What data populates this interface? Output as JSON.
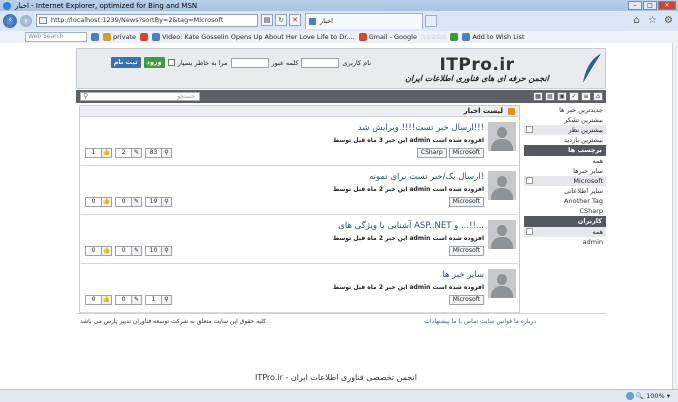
{
  "browser": {
    "title": "اخبار - Internet Explorer, optimized for Bing and MSN",
    "address": "http://localhost:1239/News?sortBy=2&tag=Microsoft",
    "tab_label": "اخبار",
    "search_placeholder": "Web Search",
    "toolbar_items": [
      "private",
      "Video: Kate Gosselin Opens Up About Her Love Life to Dr....",
      "Gmail - Google",
      "Add to Wish List"
    ],
    "zoom": "100%"
  },
  "site": {
    "logo": "ITPro.ir",
    "tagline": "انجمن حرفه ای های فناوری اطلاعات ایران",
    "login": {
      "username_label": "نام کاربری",
      "password_label": "کلمه عبور",
      "remember_label": "مرا به خاطر بسپار",
      "login_button": "ورود",
      "register_button": "ثبت نام"
    },
    "search_placeholder": "جستجو"
  },
  "sidebar": {
    "tabs": [
      {
        "label": "جدیدترین خبر ها",
        "style": "link"
      },
      {
        "label": "بیشترین تشکر",
        "style": "link"
      },
      {
        "label": "بیشترین نظر",
        "style": "tab"
      },
      {
        "label": "بیشترین بازدید",
        "style": "link"
      }
    ],
    "tags_header": "برچسب ها",
    "tags": [
      {
        "label": "همه",
        "style": "link"
      },
      {
        "label": "سایر خبرها",
        "style": "link"
      },
      {
        "label": "Microsoft",
        "style": "tab"
      },
      {
        "label": "سایر اطلاعاتی",
        "style": "link"
      },
      {
        "label": "Another Tag",
        "style": "link"
      },
      {
        "label": "CSharp",
        "style": "link"
      }
    ],
    "users_header": "کاربران",
    "users": [
      {
        "label": "همه",
        "style": "tab"
      },
      {
        "label": "admin",
        "style": "link"
      }
    ]
  },
  "news": {
    "header": "لیست اخبار",
    "items": [
      {
        "title": "ارسال خبر تست!!!! ویرایش شد!!!",
        "meta": "این خبر 3 ماه قبل توسط admin افزوده شده است",
        "tags": [
          "Microsoft",
          "CSharp"
        ],
        "views": "83",
        "comments": "2",
        "likes": "1"
      },
      {
        "title": "ارسال یک/خبر تست برای نمونه!",
        "meta": "این خبر 2 ماه قبل توسط admin افزوده شده است",
        "tags": [
          "Microsoft"
        ],
        "views": "19",
        "comments": "0",
        "likes": "0"
      },
      {
        "title": "آشنایی با ویژگی های ASP..NET و ...!!...",
        "meta": "این خبر 2 ماه قبل توسط admin افزوده شده است",
        "tags": [
          "Microsoft"
        ],
        "views": "10",
        "comments": "0",
        "likes": "0"
      },
      {
        "title": "سایر خبر ها",
        "meta": "این خبر 2 ماه قبل توسط admin افزوده شده است",
        "tags": [
          "Microsoft"
        ],
        "views": "1",
        "comments": "0",
        "likes": "0"
      }
    ]
  },
  "footer": {
    "links": "درباره ما   قوانین سایت   تماس با ما   پیشنهادات",
    "copyright": "کلیه حقوق این سایت متعلق به شرکت توسعه فناوران تدبیر پارس می باشد.",
    "bottom": "ITPro.ir - انجمن تخصصی فناوری اطلاعات ایران"
  }
}
